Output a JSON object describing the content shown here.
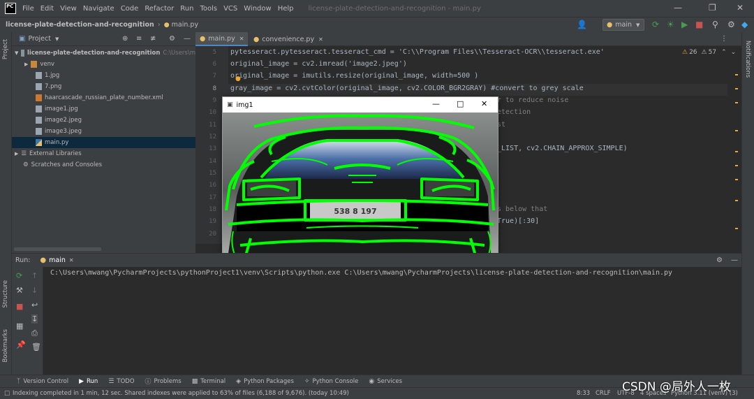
{
  "app": {
    "logo": "PC",
    "menu": [
      "File",
      "Edit",
      "View",
      "Navigate",
      "Code",
      "Refactor",
      "Run",
      "Tools",
      "VCS",
      "Window",
      "Help"
    ],
    "window_title": "license-plate-detection-and-recognition - main.py"
  },
  "navbar": {
    "project": "license-plate-detection-and-recognition",
    "file": "main.py",
    "run_config": "main"
  },
  "left_stripe": {
    "project_label": "Project",
    "structure_label": "Structure",
    "bookmarks_label": "Bookmarks"
  },
  "right_stripe": {
    "notifications_label": "Notifications"
  },
  "project_panel": {
    "title": "Project",
    "root": "license-plate-detection-and-recognition",
    "root_path": "C:\\Users\\m",
    "items": [
      {
        "label": "venv",
        "kind": "folder"
      },
      {
        "label": "1.jpg",
        "kind": "image"
      },
      {
        "label": "7.png",
        "kind": "image"
      },
      {
        "label": "haarcascade_russian_plate_number.xml",
        "kind": "xml"
      },
      {
        "label": "image1.jpg",
        "kind": "image"
      },
      {
        "label": "image2.jpeg",
        "kind": "image"
      },
      {
        "label": "image3.jpeg",
        "kind": "image"
      },
      {
        "label": "main.py",
        "kind": "python"
      }
    ],
    "external": "External Libraries",
    "scratches": "Scratches and Consoles"
  },
  "editor": {
    "tabs": [
      {
        "label": "main.py",
        "active": true
      },
      {
        "label": "convenience.py",
        "active": false
      }
    ],
    "warnings": "26",
    "weak_warnings": "57",
    "line_numbers": [
      "5",
      "6",
      "7",
      "8",
      "9",
      "10",
      "11",
      "12",
      "13",
      "14",
      "15",
      "16",
      "17",
      "18",
      "19",
      "20"
    ],
    "visible_code": {
      "l5": "pytesseract.pytesseract.tesseract_cmd = 'C:\\\\Program Files\\\\Tesseract-OCR\\\\tesseract.exe'",
      "l6": "original_image = cv2.imread('image2.jpeg')",
      "l7": "original_image = imutils.resize(original_image, width=500 )",
      "l8": "gray_image = cv2.cvtColor(original_image, cv2.COLOR_BGR2GRAY) #convert to grey scale",
      "l9_tail": "r to reduce noise",
      "l10_tail": "etection",
      "l11_tail": "st",
      "l13_tail": "_LIST, cv2.CHAIN_APPROX_SIMPLE)",
      "l18_tail": "s below that",
      "l19_tail": "True)[:30]"
    }
  },
  "image_window": {
    "title": "img1",
    "plate_text": "538 8 197"
  },
  "run_panel": {
    "label": "Run:",
    "tab": "main",
    "command": "C:\\Users\\mwang\\PycharmProjects\\pythonProject1\\venv\\Scripts\\python.exe C:\\Users\\mwang\\PycharmProjects\\license-plate-detection-and-recognition\\main.py"
  },
  "tool_tabs": [
    {
      "label": "Version Control",
      "icon": "vcs-icon"
    },
    {
      "label": "Run",
      "icon": "run-icon",
      "active": true
    },
    {
      "label": "TODO",
      "icon": "todo-icon"
    },
    {
      "label": "Problems",
      "icon": "problems-icon"
    },
    {
      "label": "Terminal",
      "icon": "terminal-icon"
    },
    {
      "label": "Python Packages",
      "icon": "packages-icon"
    },
    {
      "label": "Python Console",
      "icon": "console-icon"
    },
    {
      "label": "Services",
      "icon": "services-icon"
    }
  ],
  "status": {
    "message": "Indexing completed in 1 min, 12 sec. Shared indexes were applied to 63% of files (6,188 of 9,676). (today 10:49)",
    "position": "8:33",
    "line_sep": "CRLF",
    "encoding": "UTF-8",
    "indent": "4 spaces",
    "interpreter": "Python 3.11 (venv) (3)"
  },
  "watermark": "CSDN @局外人一枚",
  "colors": {
    "bg": "#2b2b2b",
    "panel": "#3c3f41",
    "accent": "#4a88c7",
    "contour_green": "#00ff00",
    "string": "#6a8759",
    "keyword": "#cc7832",
    "number": "#6897bb"
  }
}
